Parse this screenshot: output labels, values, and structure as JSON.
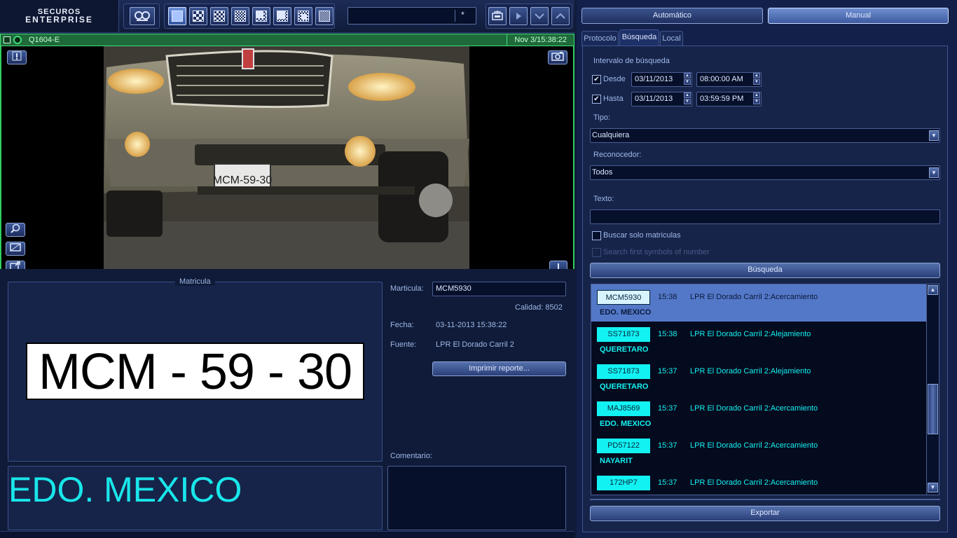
{
  "logo": {
    "line1": "SECUROS",
    "line2": "ENTERPRISE"
  },
  "toolbar": {
    "camera_search_value": "*"
  },
  "camera": {
    "name": "Q1604-E",
    "timestamp": "Nov 3/15:38:22"
  },
  "plate_panel": {
    "legend": "Matricula",
    "plate_text": "MCM - 59 - 30",
    "state_text": "EDO. MEXICO"
  },
  "details": {
    "matricula_label": "Marticula:",
    "matricula_value": "MCM5930",
    "quality_text": "Calidad: 8502",
    "date_label": "Fecha:",
    "date_value": "03-11-2013 15:38:22",
    "source_label": "Fuente:",
    "source_value": "LPR El Dorado Carril 2",
    "print_button": "Imprimir reporte...",
    "comment_label": "Comentario:"
  },
  "mode": {
    "auto": "Automático",
    "manual": "Manual"
  },
  "tabs": [
    {
      "label": "Protocolo"
    },
    {
      "label": "Búsqueda"
    },
    {
      "label": "Local"
    }
  ],
  "search": {
    "interval_title": "Intervalo de búsqueda",
    "from_label": "Desde",
    "from_date": "03/11/2013",
    "from_time": "08:00:00 AM",
    "to_label": "Hasta",
    "to_date": "03/11/2013",
    "to_time": "03:59:59 PM",
    "type_label": "Tipo:",
    "type_value": "Cualquiera",
    "recognizer_label": "Reconocedor:",
    "recognizer_value": "Todos",
    "text_label": "Texto:",
    "text_value": "",
    "plates_only_label": "Buscar solo matriculas",
    "first_symbols_label": "Search first symbols of number",
    "search_button": "Búsqueda",
    "export_button": "Exportar"
  },
  "results": [
    {
      "plate": "MCM5930",
      "time": "15:38",
      "source": "LPR El Dorado Carril 2:Acercamiento",
      "state": "EDO. MEXICO",
      "selected": true
    },
    {
      "plate": "SS71873",
      "time": "15:38",
      "source": "LPR El Dorado Carril 2:Alejamiento",
      "state": "QUERETARO",
      "selected": false
    },
    {
      "plate": "SS71873",
      "time": "15:37",
      "source": "LPR El Dorado Carril 2:Alejamiento",
      "state": "QUERETARO",
      "selected": false
    },
    {
      "plate": "MAJ8569",
      "time": "15:37",
      "source": "LPR El Dorado Carril 2:Acercamiento",
      "state": "EDO. MEXICO",
      "selected": false
    },
    {
      "plate": "PD57122",
      "time": "15:37",
      "source": "LPR El Dorado Carril 2:Acercamiento",
      "state": "NAYARIT",
      "selected": false
    },
    {
      "plate": "172HP7",
      "time": "15:37",
      "source": "LPR El Dorado Carril 2:Acercamiento",
      "state": "",
      "selected": false
    }
  ],
  "colors": {
    "accent": "#13f2f2",
    "selected_row": "#5478c8",
    "camera_ok": "#3fe07a"
  }
}
